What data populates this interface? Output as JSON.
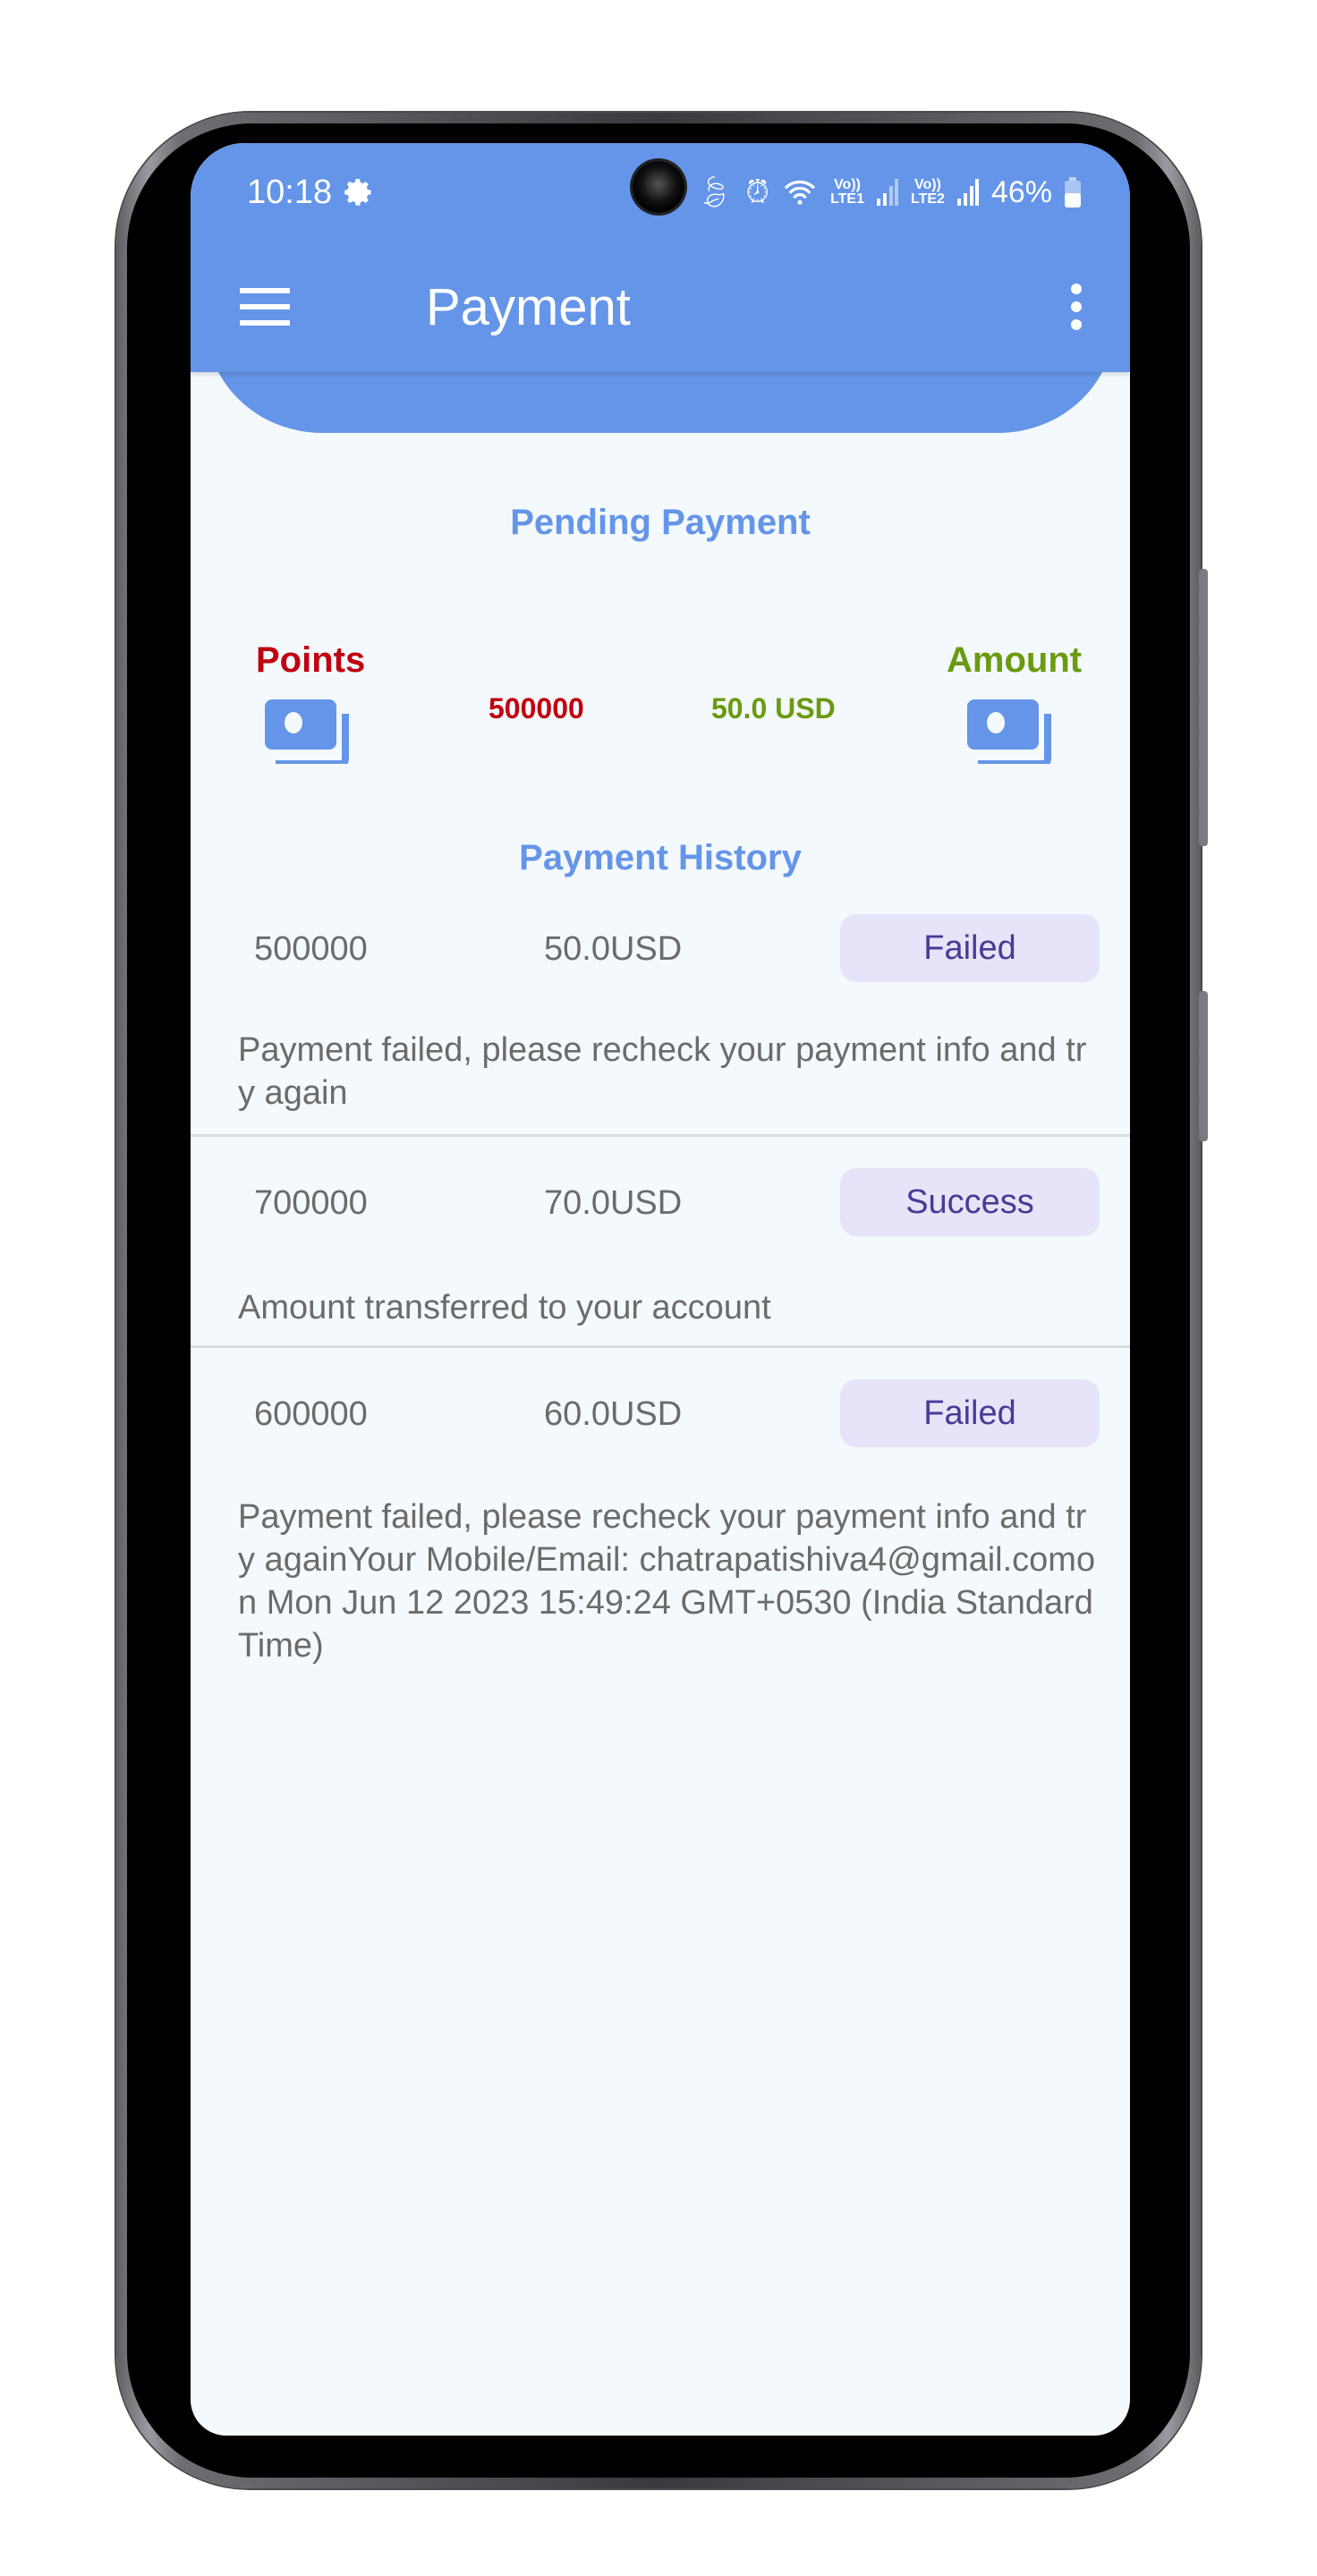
{
  "status_bar": {
    "time": "10:18",
    "battery": "46%",
    "sim1_label": "LTE1",
    "sim2_label": "LTE2",
    "volte_label": "Vo))"
  },
  "app_bar": {
    "title": "Payment"
  },
  "pending": {
    "title": "Pending Payment",
    "points_label": "Points",
    "points_value": "500000",
    "amount_value": "50.0 USD",
    "amount_label": "Amount"
  },
  "history": {
    "title": "Payment History",
    "items": [
      {
        "points": "500000",
        "amount": "50.0USD",
        "status": "Failed",
        "message": "Payment failed, please recheck your payment info and try again"
      },
      {
        "points": "700000",
        "amount": "70.0USD",
        "status": "Success",
        "message": "Amount transferred to your account"
      },
      {
        "points": "600000",
        "amount": "60.0USD",
        "status": "Failed",
        "message": "Payment failed, please recheck your payment info and try againYour Mobile/Email: chatrapatishiva4@gmail.comon Mon Jun 12 2023 15:49:24 GMT+0530 (India Standard Time)"
      }
    ]
  },
  "colors": {
    "primary": "#6495e8",
    "points": "#c00010",
    "amount": "#6a9a10",
    "chip_bg": "#e6e4f8",
    "chip_text": "#4a3a96",
    "background": "#f4f9fd"
  }
}
